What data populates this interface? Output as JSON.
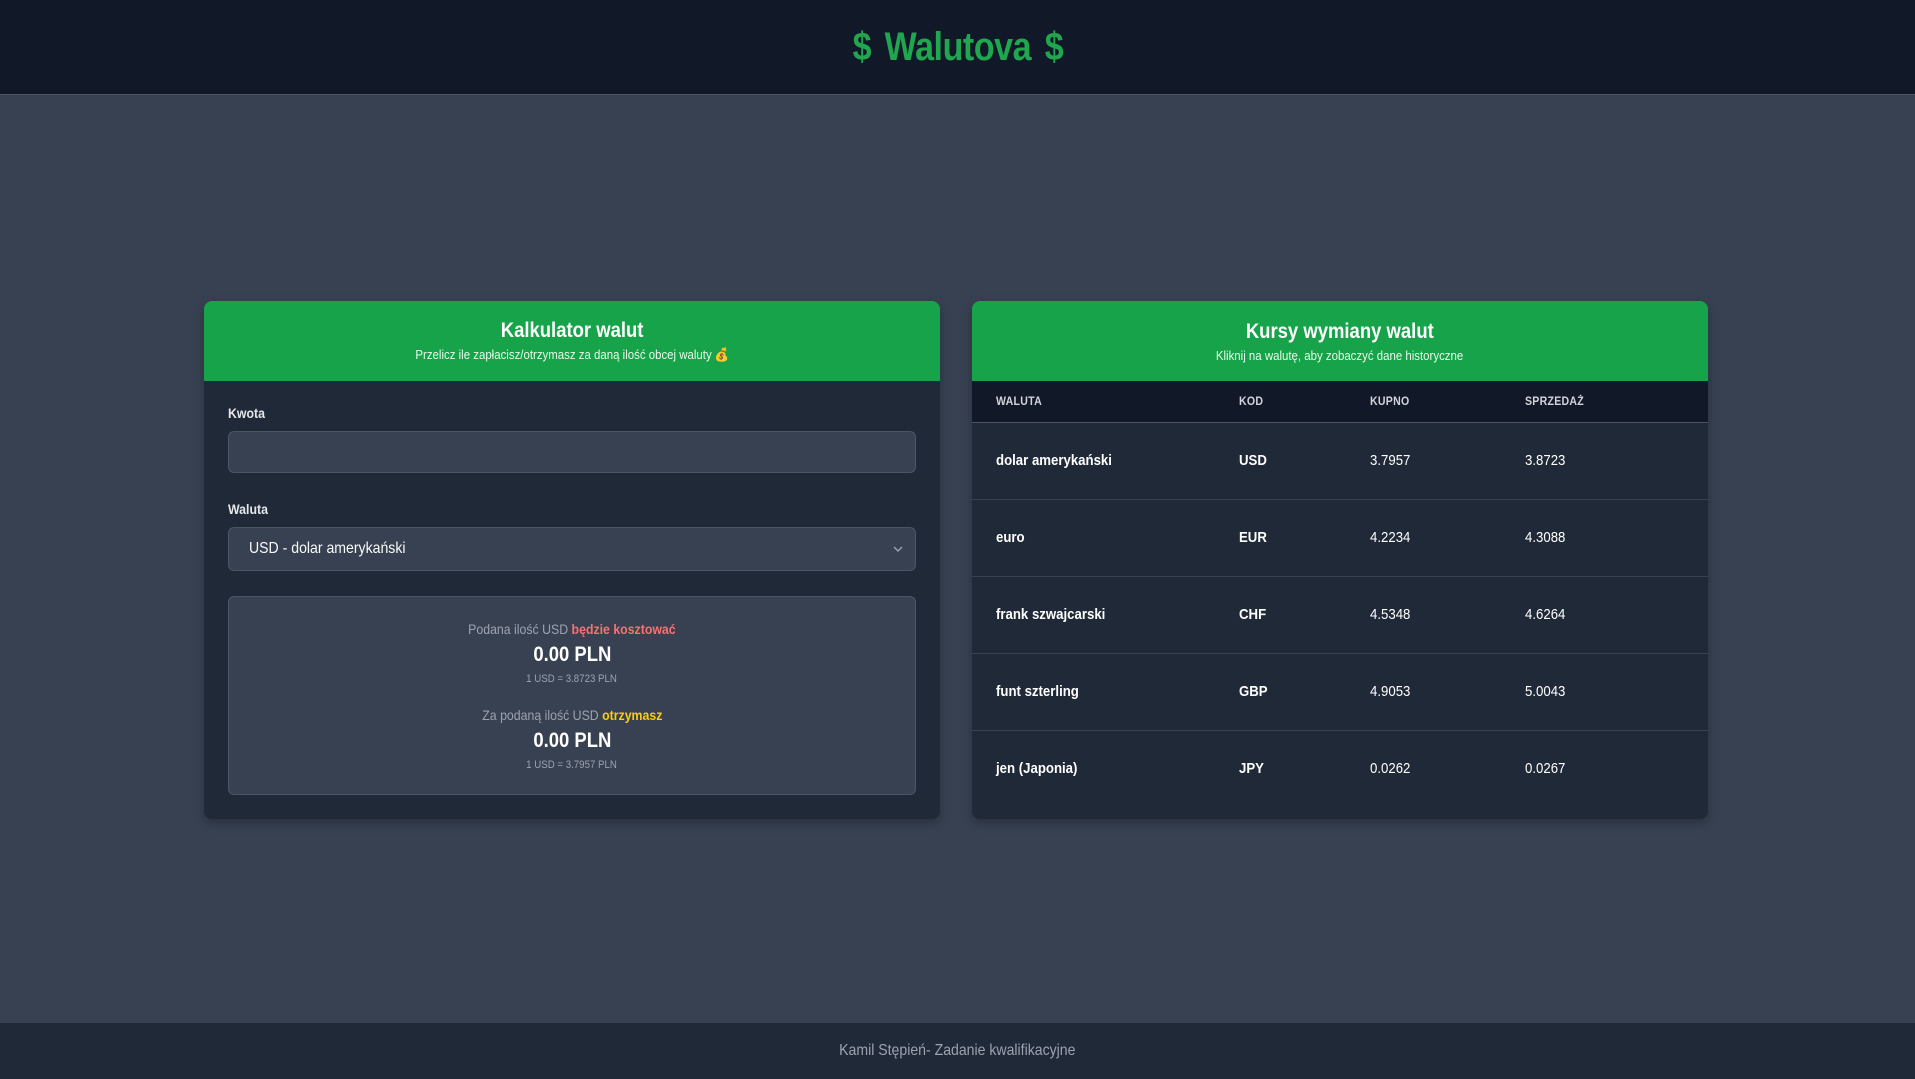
{
  "header": {
    "title": "Walutova",
    "symbol_left": "$",
    "symbol_right": "$",
    "accent_color": "#1fa64f"
  },
  "calculator": {
    "title": "Kalkulator walut",
    "subtitle": "Przelicz ile zapłacisz/otrzymasz za daną ilość obcej waluty 💰",
    "amount_label": "Kwota",
    "amount_value": "",
    "currency_label": "Waluta",
    "currency_selected": "USD - dolar amerykański",
    "cost": {
      "prefix": "Podana ilość USD",
      "highlight": "będzie kosztować",
      "amount": "0.00 PLN",
      "rate": "1 USD = 3.8723 PLN"
    },
    "receive": {
      "prefix": "Za podaną ilość USD",
      "highlight": "otrzymasz",
      "amount": "0.00 PLN",
      "rate": "1 USD = 3.7957 PLN"
    }
  },
  "rates": {
    "title": "Kursy wymiany walut",
    "subtitle": "Kliknij na walutę, aby zobaczyć dane historyczne",
    "columns": [
      "WALUTA",
      "KOD",
      "KUPNO",
      "SPRZEDAŻ"
    ],
    "rows": [
      {
        "name": "dolar amerykański",
        "code": "USD",
        "buy": "3.7957",
        "sell": "3.8723"
      },
      {
        "name": "euro",
        "code": "EUR",
        "buy": "4.2234",
        "sell": "4.3088"
      },
      {
        "name": "frank szwajcarski",
        "code": "CHF",
        "buy": "4.5348",
        "sell": "4.6264"
      },
      {
        "name": "funt szterling",
        "code": "GBP",
        "buy": "4.9053",
        "sell": "5.0043"
      },
      {
        "name": "jen (Japonia)",
        "code": "JPY",
        "buy": "0.0262",
        "sell": "0.0267"
      }
    ]
  },
  "footer": {
    "text": "Kamil Stępień- Zadanie kwalifikacyjne"
  }
}
